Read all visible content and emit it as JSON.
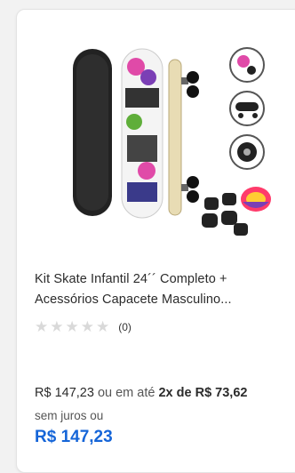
{
  "product": {
    "title_line1": "Kit Skate Infantil 24´´ Completo +",
    "title_line2": "Acessórios Capacete Masculino...",
    "rating_count": "(0)",
    "stars_filled": 0,
    "stars_total": 5,
    "price": "R$ 147,23",
    "installment_text": "ou em até",
    "installment_value": "2x de R$ 73,62",
    "installment_suffix": "sem juros ou",
    "cash_price": "R$ 147,23"
  },
  "colors": {
    "accent_price": "#1565d8",
    "star_empty": "#d9d9d9"
  },
  "icons": {
    "star": "star-icon"
  }
}
